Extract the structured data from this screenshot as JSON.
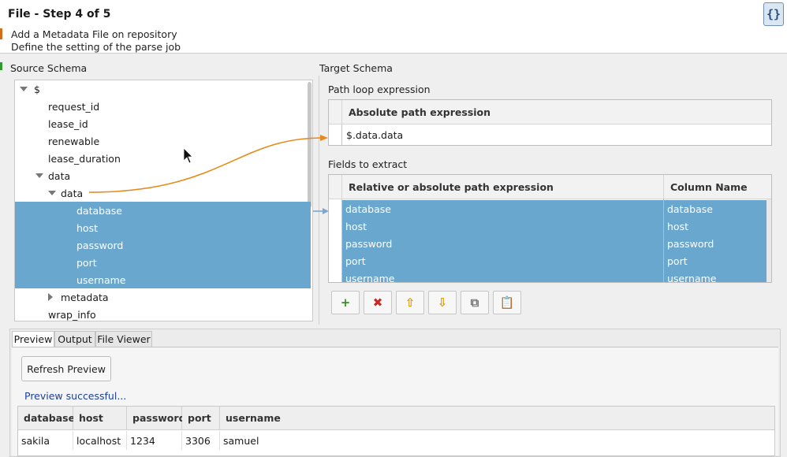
{
  "header": {
    "title": "File - Step 4 of 5",
    "line1": "Add a Metadata File on repository",
    "line2": "Define the setting of the parse job",
    "icon": "{}"
  },
  "source_schema": {
    "label": "Source Schema",
    "nodes": [
      {
        "label": "$",
        "indent": 0,
        "expander": "down",
        "selected": false
      },
      {
        "label": "request_id",
        "indent": 2,
        "expander": "none",
        "selected": false
      },
      {
        "label": "lease_id",
        "indent": 2,
        "expander": "none",
        "selected": false
      },
      {
        "label": "renewable",
        "indent": 2,
        "expander": "none",
        "selected": false
      },
      {
        "label": "lease_duration",
        "indent": 2,
        "expander": "none",
        "selected": false
      },
      {
        "label": "data",
        "indent": 2,
        "expander": "down",
        "selected": false
      },
      {
        "label": "data",
        "indent": 3,
        "expander": "down",
        "selected": false
      },
      {
        "label": "database",
        "indent": 4,
        "expander": "none",
        "selected": true
      },
      {
        "label": "host",
        "indent": 4,
        "expander": "none",
        "selected": true
      },
      {
        "label": "password",
        "indent": 4,
        "expander": "none",
        "selected": true
      },
      {
        "label": "port",
        "indent": 4,
        "expander": "none",
        "selected": true
      },
      {
        "label": "username",
        "indent": 4,
        "expander": "none",
        "selected": true
      },
      {
        "label": "metadata",
        "indent": 3,
        "expander": "right",
        "selected": false
      },
      {
        "label": "wrap_info",
        "indent": 2,
        "expander": "none",
        "selected": false
      }
    ]
  },
  "target_schema": {
    "label": "Target Schema",
    "loop_label": "Path loop expression",
    "loop_header": "Absolute path expression",
    "loop_value": "$.data.data",
    "fields_label": "Fields to extract",
    "fields_headers": [
      "Relative or absolute path expression",
      "Column Name"
    ],
    "fields": [
      {
        "path": "database",
        "column": "database"
      },
      {
        "path": "host",
        "column": "host"
      },
      {
        "path": "password",
        "column": "password"
      },
      {
        "path": "port",
        "column": "port"
      },
      {
        "path": "username",
        "column": "username"
      }
    ],
    "toolbar": [
      {
        "icon": "add-icon",
        "glyph": "+",
        "color": "#3a8d2a"
      },
      {
        "icon": "delete-icon",
        "glyph": "✖",
        "color": "#c62828"
      },
      {
        "icon": "move-up-icon",
        "glyph": "⇧",
        "color": "#d99a00"
      },
      {
        "icon": "move-down-icon",
        "glyph": "⇩",
        "color": "#d99a00"
      },
      {
        "icon": "copy-icon",
        "glyph": "⧉",
        "color": "#777777"
      },
      {
        "icon": "paste-icon",
        "glyph": "📋",
        "color": "#777777"
      }
    ]
  },
  "bottom": {
    "tabs": [
      {
        "label": "Preview",
        "active": true
      },
      {
        "label": "Output",
        "active": false
      },
      {
        "label": "File Viewer",
        "active": false
      }
    ],
    "refresh_label": "Refresh Preview",
    "status": "Preview successful...",
    "preview_headers": [
      "database",
      "host",
      "password",
      "port",
      "username"
    ],
    "preview_row": [
      "sakila",
      "localhost",
      "1234",
      "3306",
      "samuel"
    ]
  },
  "colors": {
    "selection": "#6aa7cf",
    "loop_link": "#e8891a",
    "field_link": "#7aa7d6"
  }
}
